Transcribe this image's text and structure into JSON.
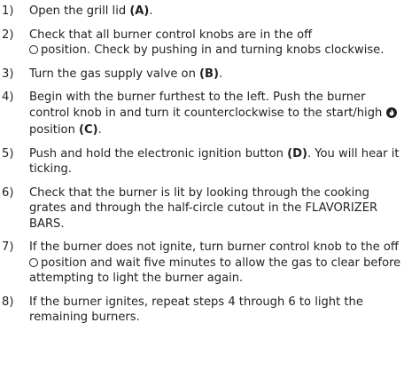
{
  "steps": [
    {
      "num": "1)",
      "before": "Open the grill lid ",
      "ref": "(A)",
      "after": "."
    },
    {
      "num": "2)",
      "line1": "Check that all burner control knobs are in the off",
      "after": "position. Check by pushing in and turning knobs clockwise."
    },
    {
      "num": "3)",
      "before": "Turn the gas supply valve on ",
      "ref": "(B)",
      "after": "."
    },
    {
      "num": "4)",
      "before": "Begin with the burner furthest to the left. Push the burner control knob in and turn it counterclockwise to the start/high",
      "after": "position ",
      "ref": "(C)",
      "end": "."
    },
    {
      "num": "5)",
      "before": "Push and hold the electronic ignition button ",
      "ref": "(D)",
      "after": ". You will hear it ticking."
    },
    {
      "num": "6)",
      "text": "Check that the burner is lit by looking through the cooking grates and through the half-circle cutout in the FLAVORIZER BARS."
    },
    {
      "num": "7)",
      "before": "If the burner does not ignite, turn burner control knob to the off",
      "after": "position and wait five minutes to allow the gas to clear before attempting to light the burner again."
    },
    {
      "num": "8)",
      "text": "If the burner ignites, repeat steps 4 through 6 to light the remaining burners."
    }
  ],
  "icons": {
    "off": "off-position-icon",
    "flame": "start-high-flame-icon"
  }
}
